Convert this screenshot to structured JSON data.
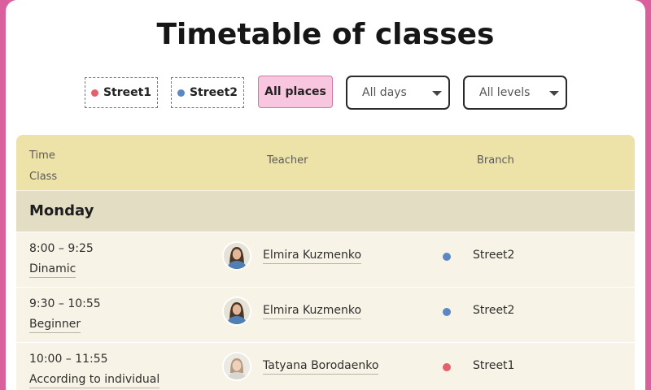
{
  "title": "Timetable of classes",
  "filters": {
    "street1": {
      "label": "Street1",
      "color": "#e4606d"
    },
    "street2": {
      "label": "Street2",
      "color": "#5b87c4"
    },
    "all_places": "All places",
    "days_select": "All days",
    "levels_select": "All levels"
  },
  "table": {
    "headers": {
      "time": "Time",
      "class": "Class",
      "teacher": "Teacher",
      "branch": "Branch"
    },
    "day": "Monday",
    "rows": [
      {
        "time": "8:00 – 9:25",
        "class": "Dinamic",
        "teacher": "Elmira Kuzmenko",
        "branch": "Street2",
        "branch_color": "#5b87c4",
        "avatar": "woman-dark-hair-avatar"
      },
      {
        "time": "9:30 – 10:55",
        "class": "Beginner",
        "teacher": "Elmira Kuzmenko",
        "branch": "Street2",
        "branch_color": "#5b87c4",
        "avatar": "woman-dark-hair-avatar"
      },
      {
        "time": "10:00 – 11:55",
        "class": "According to individual",
        "teacher": "Tatyana Borodaenko",
        "branch": "Street1",
        "branch_color": "#e4606d",
        "avatar": "woman-light-hair-avatar"
      }
    ]
  }
}
